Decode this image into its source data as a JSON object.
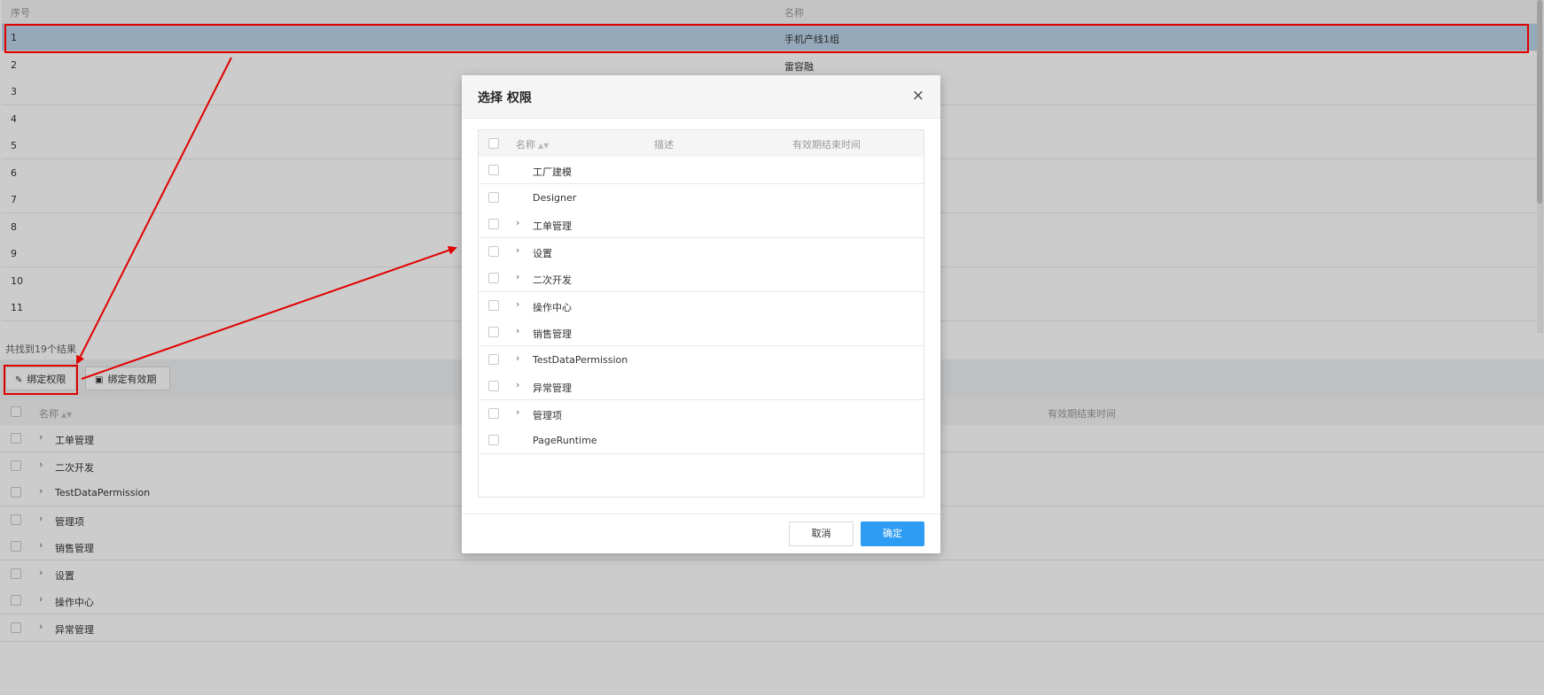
{
  "top_table": {
    "headers": [
      "序号",
      "名称"
    ],
    "rows": [
      {
        "no": "1",
        "name": "手机产线1组"
      },
      {
        "no": "2",
        "name": "雷容融"
      },
      {
        "no": "3",
        "name": ""
      },
      {
        "no": "4",
        "name": ""
      },
      {
        "no": "5",
        "name": ""
      },
      {
        "no": "6",
        "name": ""
      },
      {
        "no": "7",
        "name": ""
      },
      {
        "no": "8",
        "name": ""
      },
      {
        "no": "9",
        "name": ""
      },
      {
        "no": "10",
        "name": ""
      },
      {
        "no": "11",
        "name": ""
      }
    ],
    "selected_row": "1"
  },
  "result_count": "共找到19个结果",
  "toolbar": {
    "bind_permission": "绑定权限",
    "bind_validity": "绑定有效期"
  },
  "bottom_table": {
    "headers": {
      "name": "名称",
      "end_time": "有效期结束时间"
    },
    "rows": [
      "工单管理",
      "二次开发",
      "TestDataPermission",
      "管理项",
      "销售管理",
      "设置",
      "操作中心",
      "异常管理"
    ]
  },
  "modal": {
    "title": "选择 权限",
    "close": "×",
    "headers": {
      "name": "名称",
      "desc": "描述",
      "end_time": "有效期结束时间"
    },
    "rows": [
      {
        "name": "工厂建模",
        "expandable": false
      },
      {
        "name": "Designer",
        "expandable": false
      },
      {
        "name": "工单管理",
        "expandable": true
      },
      {
        "name": "设置",
        "expandable": true
      },
      {
        "name": "二次开发",
        "expandable": true
      },
      {
        "name": "操作中心",
        "expandable": true
      },
      {
        "name": "销售管理",
        "expandable": true
      },
      {
        "name": "TestDataPermission",
        "expandable": true
      },
      {
        "name": "异常管理",
        "expandable": true
      },
      {
        "name": "管理项",
        "expandable": true
      },
      {
        "name": "PageRuntime",
        "expandable": false
      }
    ],
    "cancel": "取消",
    "ok": "确定"
  },
  "icons": {
    "edit": "edit-icon",
    "calendar": "calendar-icon",
    "chevron": "chevron-right-icon",
    "sort": "sort-icon"
  },
  "colors": {
    "primary": "#2e9cf2",
    "selected_row": "#bcd4ea",
    "annotation": "#e00000"
  }
}
